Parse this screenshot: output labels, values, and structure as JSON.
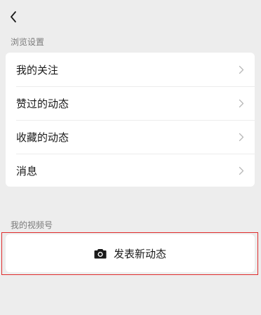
{
  "header": {
    "back_icon": "chevron-left-icon"
  },
  "browse_settings": {
    "section_label": "浏览设置",
    "items": [
      {
        "label": "我的关注",
        "icon": "chevron-right-icon"
      },
      {
        "label": "赞过的动态",
        "icon": "chevron-right-icon"
      },
      {
        "label": "收藏的动态",
        "icon": "chevron-right-icon"
      },
      {
        "label": "消息",
        "icon": "chevron-right-icon"
      }
    ]
  },
  "my_channel": {
    "section_label": "我的视频号",
    "post_button": {
      "label": "发表新动态",
      "icon": "camera-icon"
    },
    "highlight_color": "#e02b2b"
  }
}
